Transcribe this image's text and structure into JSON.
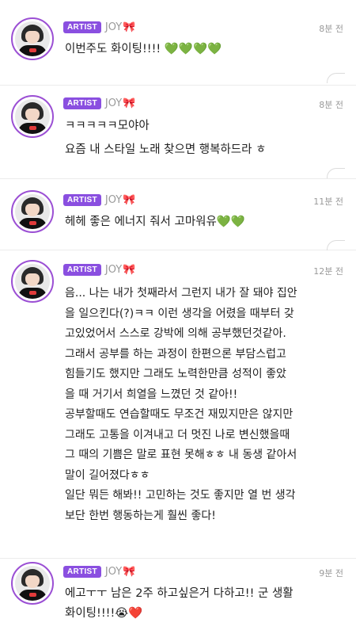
{
  "comments": [
    {
      "badge": "ARTIST",
      "name": "JOY",
      "bow": "🎀",
      "time": "8분 전",
      "lines": [
        "이번주도 화이팅!!!! 💚💚💚💚"
      ]
    },
    {
      "badge": "ARTIST",
      "name": "JOY",
      "bow": "🎀",
      "time": "8분 전",
      "lines": [
        "ㅋㅋㅋㅋㅋ모야아",
        "요즘 내 스타일 노래 찾으면 행복하드라 ㅎ"
      ]
    },
    {
      "badge": "ARTIST",
      "name": "JOY",
      "bow": "🎀",
      "time": "11분 전",
      "lines": [
        "헤헤 좋은 에너지 줘서 고마워유💚💚"
      ]
    },
    {
      "badge": "ARTIST",
      "name": "JOY",
      "bow": "🎀",
      "time": "12분 전",
      "lines": [
        "음... 나는 내가 첫째라서 그런지 내가 잘 돼야 집안",
        "을 일으킨다(?)ㅋㅋ 이런 생각을 어렸을 때부터 갖",
        "고있었어서 스스로 강박에 의해 공부했던것같아.",
        "그래서 공부를 하는 과정이 한편으론 부담스럽고",
        "힘들기도 했지만 그래도 노력한만큼 성적이 좋았",
        "을 때 거기서 희열을 느꼈던 것 같아!!",
        "공부할때도 연습할때도 무조건 재밌지만은 않지만",
        "그래도 고통을 이겨내고 더 멋진 나로 변신했을때",
        "그 때의 기쁨은 말로 표현 못해ㅎㅎ 내 동생 같아서",
        "말이 길어졌다ㅎㅎ",
        "일단 뭐든 해봐!! 고민하는 것도 좋지만 열 번 생각",
        "보단 한번 행동하는게 훨씬 좋다!"
      ]
    },
    {
      "badge": "ARTIST",
      "name": "JOY",
      "bow": "🎀",
      "time": "9분 전",
      "lines": [
        "에고ㅜㅜ 남은 2주 하고싶은거 다하고!! 군 생활",
        "화이팅!!!!😭❤️"
      ]
    }
  ]
}
